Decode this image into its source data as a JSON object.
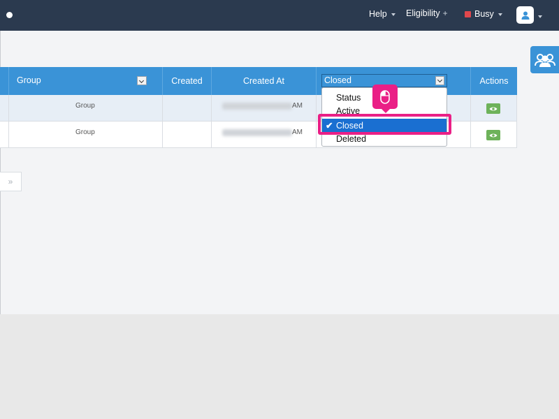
{
  "nav": {
    "help": "Help",
    "eligibility": "Eligibility",
    "eligibility_suffix": "+",
    "busy": "Busy"
  },
  "table": {
    "headers": {
      "group": "Group",
      "created": "Created",
      "created_at": "Created At",
      "status_selected": "Closed",
      "actions": "Actions"
    },
    "rows": [
      {
        "group": "Group",
        "created_at_suffix": "AM"
      },
      {
        "group": "Group",
        "created_at_suffix": "AM"
      }
    ]
  },
  "pager": {
    "next": "»"
  },
  "status_dropdown": {
    "options": [
      "Status",
      "Active",
      "Closed",
      "Deleted"
    ],
    "selected": "Closed",
    "check": "✔"
  },
  "colors": {
    "navbar": "#2b3a4f",
    "header_blue": "#3a93d7",
    "highlight_pink": "#ea1f86",
    "selected_blue": "#1a6fd1",
    "busy_red": "#e0474c",
    "view_green": "#6db25a"
  },
  "icons": [
    "user-avatar-icon",
    "group-users-icon",
    "eye-icon",
    "mouse-icon",
    "checkmark-icon"
  ]
}
